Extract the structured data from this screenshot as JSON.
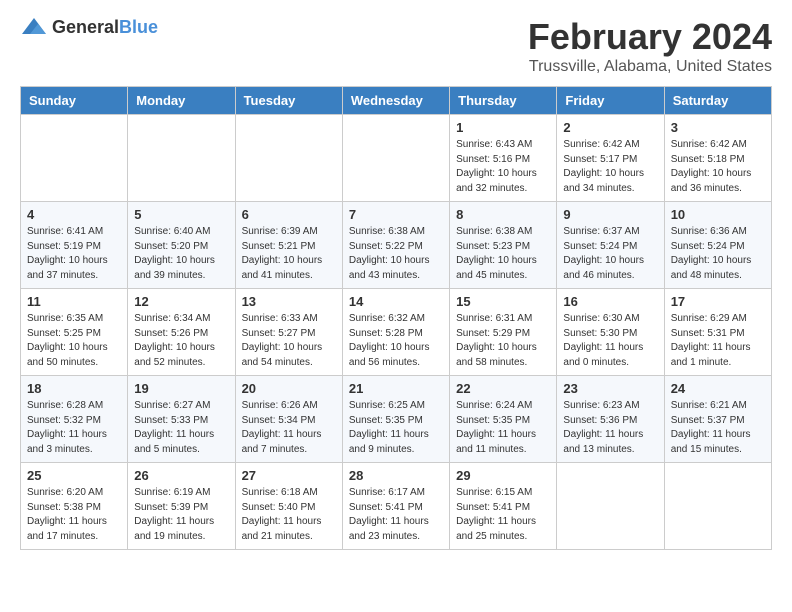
{
  "logo": {
    "general": "General",
    "blue": "Blue"
  },
  "title": "February 2024",
  "location": "Trussville, Alabama, United States",
  "days_of_week": [
    "Sunday",
    "Monday",
    "Tuesday",
    "Wednesday",
    "Thursday",
    "Friday",
    "Saturday"
  ],
  "weeks": [
    [
      {
        "day": "",
        "info": ""
      },
      {
        "day": "",
        "info": ""
      },
      {
        "day": "",
        "info": ""
      },
      {
        "day": "",
        "info": ""
      },
      {
        "day": "1",
        "info": "Sunrise: 6:43 AM\nSunset: 5:16 PM\nDaylight: 10 hours\nand 32 minutes."
      },
      {
        "day": "2",
        "info": "Sunrise: 6:42 AM\nSunset: 5:17 PM\nDaylight: 10 hours\nand 34 minutes."
      },
      {
        "day": "3",
        "info": "Sunrise: 6:42 AM\nSunset: 5:18 PM\nDaylight: 10 hours\nand 36 minutes."
      }
    ],
    [
      {
        "day": "4",
        "info": "Sunrise: 6:41 AM\nSunset: 5:19 PM\nDaylight: 10 hours\nand 37 minutes."
      },
      {
        "day": "5",
        "info": "Sunrise: 6:40 AM\nSunset: 5:20 PM\nDaylight: 10 hours\nand 39 minutes."
      },
      {
        "day": "6",
        "info": "Sunrise: 6:39 AM\nSunset: 5:21 PM\nDaylight: 10 hours\nand 41 minutes."
      },
      {
        "day": "7",
        "info": "Sunrise: 6:38 AM\nSunset: 5:22 PM\nDaylight: 10 hours\nand 43 minutes."
      },
      {
        "day": "8",
        "info": "Sunrise: 6:38 AM\nSunset: 5:23 PM\nDaylight: 10 hours\nand 45 minutes."
      },
      {
        "day": "9",
        "info": "Sunrise: 6:37 AM\nSunset: 5:24 PM\nDaylight: 10 hours\nand 46 minutes."
      },
      {
        "day": "10",
        "info": "Sunrise: 6:36 AM\nSunset: 5:24 PM\nDaylight: 10 hours\nand 48 minutes."
      }
    ],
    [
      {
        "day": "11",
        "info": "Sunrise: 6:35 AM\nSunset: 5:25 PM\nDaylight: 10 hours\nand 50 minutes."
      },
      {
        "day": "12",
        "info": "Sunrise: 6:34 AM\nSunset: 5:26 PM\nDaylight: 10 hours\nand 52 minutes."
      },
      {
        "day": "13",
        "info": "Sunrise: 6:33 AM\nSunset: 5:27 PM\nDaylight: 10 hours\nand 54 minutes."
      },
      {
        "day": "14",
        "info": "Sunrise: 6:32 AM\nSunset: 5:28 PM\nDaylight: 10 hours\nand 56 minutes."
      },
      {
        "day": "15",
        "info": "Sunrise: 6:31 AM\nSunset: 5:29 PM\nDaylight: 10 hours\nand 58 minutes."
      },
      {
        "day": "16",
        "info": "Sunrise: 6:30 AM\nSunset: 5:30 PM\nDaylight: 11 hours\nand 0 minutes."
      },
      {
        "day": "17",
        "info": "Sunrise: 6:29 AM\nSunset: 5:31 PM\nDaylight: 11 hours\nand 1 minute."
      }
    ],
    [
      {
        "day": "18",
        "info": "Sunrise: 6:28 AM\nSunset: 5:32 PM\nDaylight: 11 hours\nand 3 minutes."
      },
      {
        "day": "19",
        "info": "Sunrise: 6:27 AM\nSunset: 5:33 PM\nDaylight: 11 hours\nand 5 minutes."
      },
      {
        "day": "20",
        "info": "Sunrise: 6:26 AM\nSunset: 5:34 PM\nDaylight: 11 hours\nand 7 minutes."
      },
      {
        "day": "21",
        "info": "Sunrise: 6:25 AM\nSunset: 5:35 PM\nDaylight: 11 hours\nand 9 minutes."
      },
      {
        "day": "22",
        "info": "Sunrise: 6:24 AM\nSunset: 5:35 PM\nDaylight: 11 hours\nand 11 minutes."
      },
      {
        "day": "23",
        "info": "Sunrise: 6:23 AM\nSunset: 5:36 PM\nDaylight: 11 hours\nand 13 minutes."
      },
      {
        "day": "24",
        "info": "Sunrise: 6:21 AM\nSunset: 5:37 PM\nDaylight: 11 hours\nand 15 minutes."
      }
    ],
    [
      {
        "day": "25",
        "info": "Sunrise: 6:20 AM\nSunset: 5:38 PM\nDaylight: 11 hours\nand 17 minutes."
      },
      {
        "day": "26",
        "info": "Sunrise: 6:19 AM\nSunset: 5:39 PM\nDaylight: 11 hours\nand 19 minutes."
      },
      {
        "day": "27",
        "info": "Sunrise: 6:18 AM\nSunset: 5:40 PM\nDaylight: 11 hours\nand 21 minutes."
      },
      {
        "day": "28",
        "info": "Sunrise: 6:17 AM\nSunset: 5:41 PM\nDaylight: 11 hours\nand 23 minutes."
      },
      {
        "day": "29",
        "info": "Sunrise: 6:15 AM\nSunset: 5:41 PM\nDaylight: 11 hours\nand 25 minutes."
      },
      {
        "day": "",
        "info": ""
      },
      {
        "day": "",
        "info": ""
      }
    ]
  ]
}
